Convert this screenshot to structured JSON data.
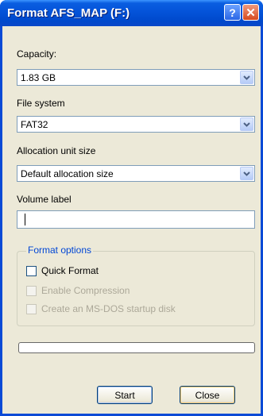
{
  "window": {
    "title": "Format AFS_MAP (F:)",
    "help_glyph": "?",
    "close_glyph": "✕"
  },
  "capacity": {
    "label": "Capacity:",
    "value": "1.83 GB"
  },
  "file_system": {
    "label": "File system",
    "value": "FAT32"
  },
  "allocation": {
    "label": "Allocation unit size",
    "value": "Default allocation size"
  },
  "volume_label": {
    "label": "Volume label",
    "value": ""
  },
  "format_options": {
    "title": "Format options",
    "quick_format": {
      "label": "Quick Format",
      "checked": false,
      "enabled": true
    },
    "enable_compression": {
      "label": "Enable Compression",
      "checked": false,
      "enabled": false
    },
    "msdos_startup": {
      "label": "Create an MS-DOS startup disk",
      "checked": false,
      "enabled": false
    }
  },
  "progress": {
    "percent": 0
  },
  "buttons": {
    "start": "Start",
    "close": "Close"
  }
}
